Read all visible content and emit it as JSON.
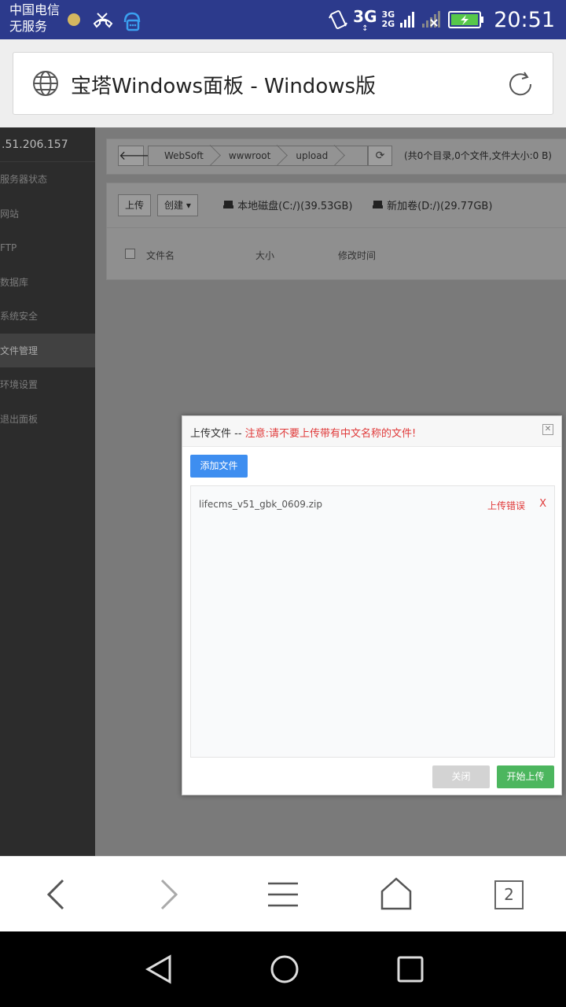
{
  "status_bar": {
    "carrier_line1": "中国电信",
    "carrier_line2": "无服务",
    "network": "3G",
    "network_top": "3G",
    "network_bottom": "2G",
    "time": "20:51"
  },
  "browser": {
    "page_title": "宝塔Windows面板 - Windows版",
    "tab_count": "2"
  },
  "sidebar": {
    "server_ip": ".51.206.157",
    "items": [
      {
        "label": "服务器状态"
      },
      {
        "label": "网站"
      },
      {
        "label": "FTP"
      },
      {
        "label": "数据库"
      },
      {
        "label": "系统安全"
      },
      {
        "label": "文件管理",
        "active": true
      },
      {
        "label": "环境设置"
      },
      {
        "label": "退出面板"
      }
    ]
  },
  "file_manager": {
    "breadcrumb": [
      "WebSoft",
      "wwwroot",
      "upload"
    ],
    "summary": "(共0个目录,0个文件,文件大小:0 B)",
    "upload_button": "上传",
    "create_button": "创建",
    "disks": [
      {
        "label": "本地磁盘(C:/)(39.53GB)"
      },
      {
        "label": "新加卷(D:/)(29.77GB)"
      }
    ],
    "columns": [
      "文件名",
      "大小",
      "修改时间"
    ]
  },
  "upload_dialog": {
    "title": "上传文件 -- ",
    "warning": "注意:请不要上传带有中文名称的文件!",
    "add_file_button": "添加文件",
    "files": [
      {
        "name": "lifecms_v51_gbk_0609.zip",
        "status": "上传错误",
        "remove": "X"
      }
    ],
    "close_button": "关闭",
    "start_button": "开始上传"
  },
  "colors": {
    "status_bar": "#2c3a8c",
    "primary_blue": "#3e8ef0",
    "success_green": "#4cb65e",
    "error_red": "#e03a3a"
  }
}
